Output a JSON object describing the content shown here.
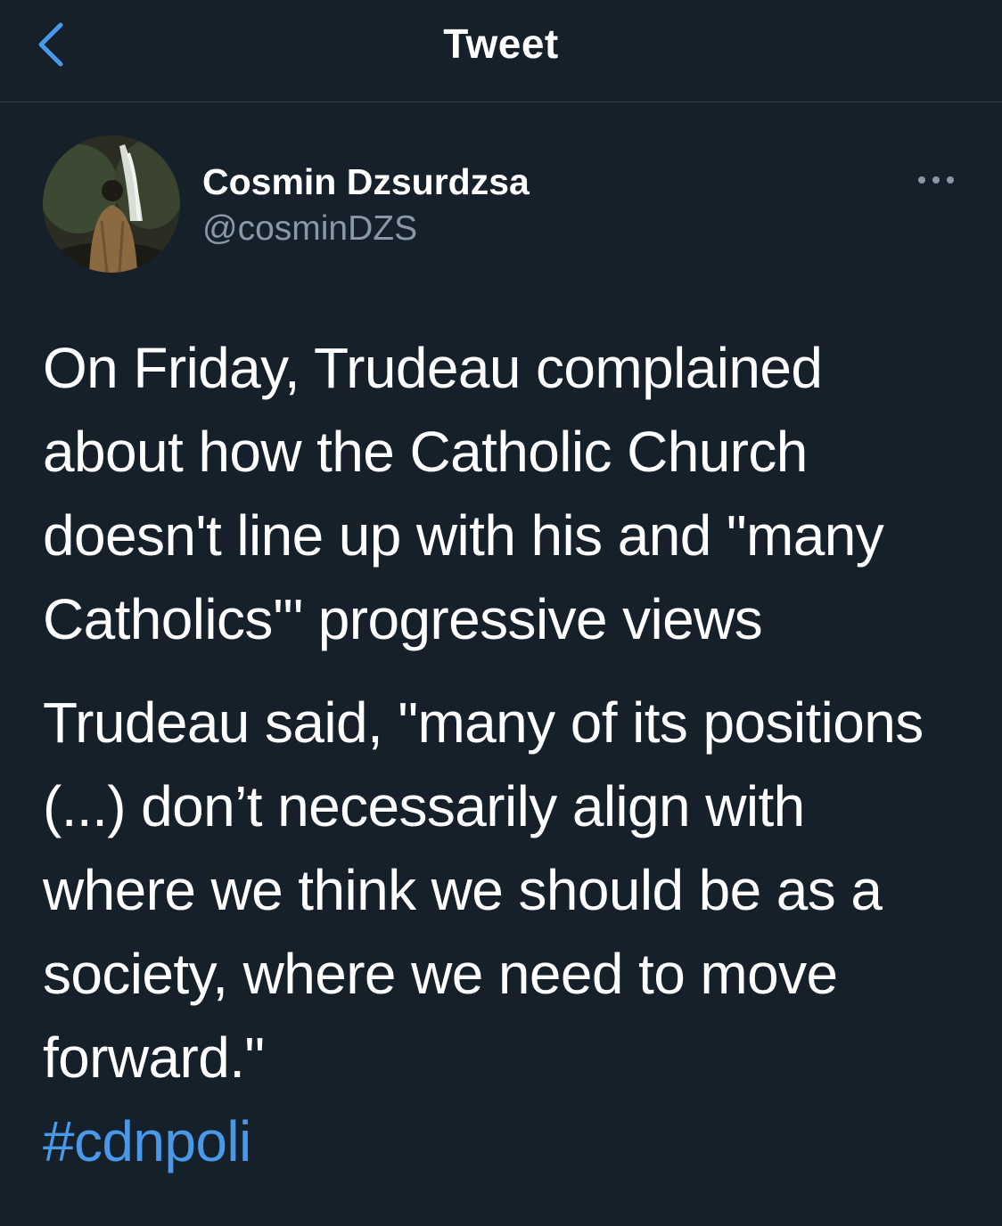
{
  "header": {
    "title": "Tweet",
    "back_icon": "chevron-left-icon",
    "accent_color": "#4a99e9"
  },
  "tweet": {
    "author": {
      "display_name": "Cosmin Dzsurdzsa",
      "handle": "@cosminDZS",
      "avatar_icon": "avatar-photo-waterfall"
    },
    "more_icon": "ellipsis-icon",
    "paragraphs": [
      "On Friday, Trudeau complained\nabout how the Catholic Church\ndoesn't line up with his and \"many\nCatholics'\" progressive views",
      "Trudeau said, \"many of its positions\n(...) don’t necessarily align with\nwhere we think we should be as a\nsociety, where we need to move\nforward.\""
    ],
    "hashtag": "#cdnpoli"
  },
  "colors": {
    "background": "#15202b",
    "text": "#ffffff",
    "secondary_text": "#8899a6",
    "divider": "#38444d",
    "link": "#4a99e9"
  }
}
